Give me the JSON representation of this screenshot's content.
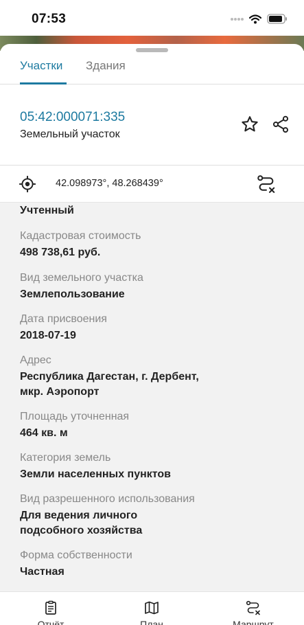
{
  "status_bar": {
    "time": "07:53"
  },
  "tabs": [
    {
      "label": "Участки",
      "active": true
    },
    {
      "label": "Здания",
      "active": false
    }
  ],
  "parcel": {
    "cadastral_number": "05:42:000071:335",
    "type": "Земельный участок"
  },
  "coordinates": {
    "text": "42.098973°, 48.268439°"
  },
  "fields": [
    {
      "label": "",
      "value": "Учтенный"
    },
    {
      "label": "Кадастровая стоимость",
      "value": "498 738,61 руб."
    },
    {
      "label": "Вид земельного участка",
      "value": "Землепользование"
    },
    {
      "label": "Дата присвоения",
      "value": "2018-07-19"
    },
    {
      "label": "Адрес",
      "value_lines": [
        "Республика Дагестан, г. Дербент,",
        "мкр. Аэропорт"
      ]
    },
    {
      "label": "Площадь уточненная",
      "value": "464 кв. м"
    },
    {
      "label": "Категория земель",
      "value": "Земли населенных пунктов"
    },
    {
      "label": "Вид разрешенного использования",
      "value_lines": [
        "Для ведения личного",
        "подсобного хозяйства"
      ]
    },
    {
      "label": "Форма собственности",
      "value": "Частная"
    }
  ],
  "bottom_nav": [
    {
      "label": "Отчёт",
      "icon": "report-icon"
    },
    {
      "label": "План",
      "icon": "map-icon"
    },
    {
      "label": "Маршрут",
      "icon": "route-icon"
    }
  ],
  "colors": {
    "accent": "#1d7aa0",
    "label_gray": "#888888",
    "details_bg": "#f2f2f2"
  }
}
